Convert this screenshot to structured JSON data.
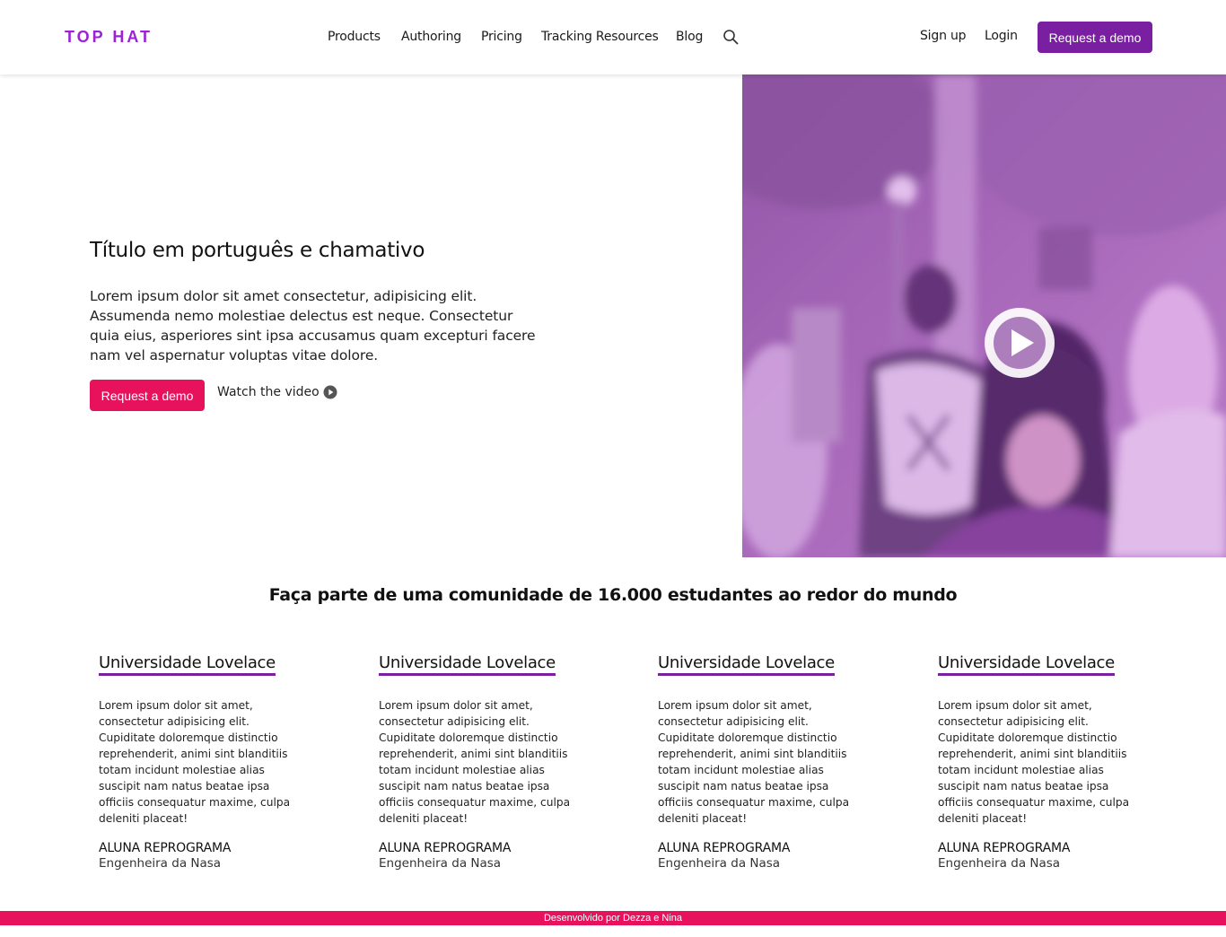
{
  "header": {
    "logo": "TOP HAT",
    "nav": [
      {
        "label": "Products"
      },
      {
        "label": "Authoring"
      },
      {
        "label": "Pricing"
      },
      {
        "label": "Tracking Resources"
      },
      {
        "label": "Blog"
      }
    ],
    "signup_label": "Sign up",
    "login_label": "Login",
    "demo_label": "Request a demo"
  },
  "hero": {
    "title": "Título em português e chamativo",
    "text": "Lorem ipsum dolor sit amet consectetur, adipisicing elit. Assumenda nemo molestiae delectus est neque. Consectetur quia eius, asperiores sint ipsa accusamus quam excepturi facere nam vel aspernatur voluptas vitae dolore.",
    "demo_label": "Request a demo",
    "watch_label": "Watch the video"
  },
  "community": {
    "title": "Faça parte de uma comunidade de 16.000 estudantes ao redor do mundo",
    "cards": [
      {
        "title": "Universidade Lovelace",
        "text": "Lorem ipsum dolor sit amet, consectetur adipisicing elit. Cupiditate doloremque distinctio reprehenderit, animi sint blanditiis totam incidunt molestiae alias suscipit nam natus beatae ipsa officiis consequatur maxime, culpa deleniti placeat!",
        "name": "ALUNA REPROGRAMA",
        "role": "Engenheira da Nasa"
      },
      {
        "title": "Universidade Lovelace",
        "text": "Lorem ipsum dolor sit amet, consectetur adipisicing elit. Cupiditate doloremque distinctio reprehenderit, animi sint blanditiis totam incidunt molestiae alias suscipit nam natus beatae ipsa officiis consequatur maxime, culpa deleniti placeat!",
        "name": "ALUNA REPROGRAMA",
        "role": "Engenheira da Nasa"
      },
      {
        "title": "Universidade Lovelace",
        "text": "Lorem ipsum dolor sit amet, consectetur adipisicing elit. Cupiditate doloremque distinctio reprehenderit, animi sint blanditiis totam incidunt molestiae alias suscipit nam natus beatae ipsa officiis consequatur maxime, culpa deleniti placeat!",
        "name": "ALUNA REPROGRAMA",
        "role": "Engenheira da Nasa"
      },
      {
        "title": "Universidade Lovelace",
        "text": "Lorem ipsum dolor sit amet, consectetur adipisicing elit. Cupiditate doloremque distinctio reprehenderit, animi sint blanditiis totam incidunt molestiae alias suscipit nam natus beatae ipsa officiis consequatur maxime, culpa deleniti placeat!",
        "name": "ALUNA REPROGRAMA",
        "role": "Engenheira da Nasa"
      }
    ]
  },
  "footer": {
    "text": "Desenvolvido por Dezza e Nina"
  },
  "colors": {
    "brand_purple": "#7b1fa2",
    "logo_purple": "#9b23d6",
    "accent_pink": "#e8115c"
  },
  "icons": {
    "search": "search-icon",
    "play": "play-icon"
  }
}
